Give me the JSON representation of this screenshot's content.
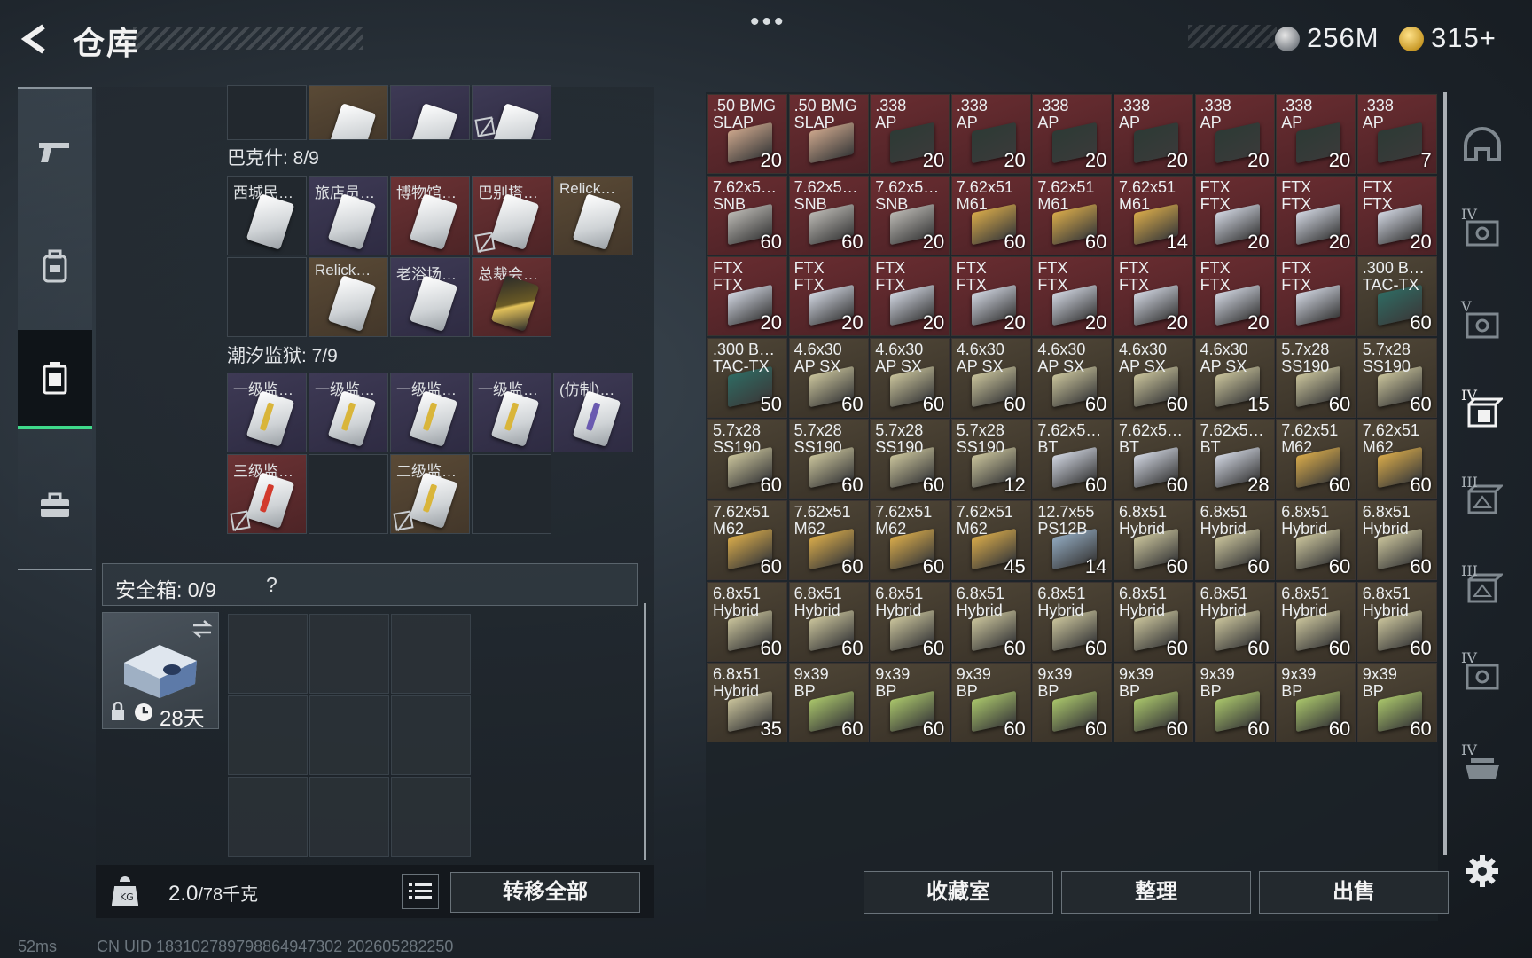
{
  "header": {
    "title": "仓库",
    "menu_dots": "•••",
    "currency_silver": "256M",
    "currency_gold": "315+"
  },
  "left_rail": {
    "items": [
      {
        "name": "weapons",
        "icon": "pistol-icon",
        "active": false
      },
      {
        "name": "gear",
        "icon": "backpack-icon",
        "active": false
      },
      {
        "name": "containers",
        "icon": "case-icon",
        "active": true
      },
      {
        "name": "toolbox",
        "icon": "toolbox-icon",
        "active": false
      }
    ]
  },
  "containers": {
    "top_row": [
      {
        "label": "",
        "color": "dark",
        "card": "none"
      },
      {
        "label": "",
        "color": "brown",
        "card": "white"
      },
      {
        "label": "",
        "color": "purple",
        "card": "white"
      },
      {
        "label": "",
        "color": "purple",
        "card": "white",
        "no_drop": true
      }
    ],
    "bakeshi": {
      "label": "巴克什: 8/9",
      "cells": [
        {
          "label": "西城民…",
          "color": "dark",
          "card": "white"
        },
        {
          "label": "旅店员…",
          "color": "purple",
          "card": "white"
        },
        {
          "label": "博物馆…",
          "color": "red",
          "card": "white"
        },
        {
          "label": "巴别塔…",
          "color": "red",
          "card": "white",
          "no_drop": true
        },
        {
          "label": "Relick…",
          "color": "brown",
          "card": "white"
        },
        {
          "label": "",
          "color": "dark",
          "card": "none"
        },
        {
          "label": "Relick…",
          "color": "brown",
          "card": "white"
        },
        {
          "label": "老浴场…",
          "color": "purple",
          "card": "white"
        },
        {
          "label": "总裁会…",
          "color": "red",
          "card": "gold"
        }
      ]
    },
    "prison": {
      "label": "潮汐监狱: 7/9",
      "cells": [
        {
          "label": "一级监…",
          "color": "purple",
          "card": "white",
          "stripe": "#d9b53a"
        },
        {
          "label": "一级监…",
          "color": "purple",
          "card": "white",
          "stripe": "#d9b53a"
        },
        {
          "label": "一级监…",
          "color": "purple",
          "card": "white",
          "stripe": "#d9b53a"
        },
        {
          "label": "一级监…",
          "color": "purple",
          "card": "white",
          "stripe": "#d9b53a"
        },
        {
          "label": "(仿制)…",
          "color": "purple",
          "card": "white",
          "stripe": "#6a5ab0"
        },
        {
          "label": "三级监…",
          "color": "red",
          "card": "white",
          "stripe": "#d23a2c",
          "no_drop": true
        },
        {
          "label": "",
          "color": "dark",
          "card": "none"
        },
        {
          "label": "二级监…",
          "color": "brown",
          "card": "white",
          "stripe": "#d9b53a",
          "no_drop": true
        },
        {
          "label": "",
          "color": "dark",
          "card": "none"
        }
      ]
    }
  },
  "safebox": {
    "label": "安全箱: 0/9",
    "help": "?",
    "timer": "28天"
  },
  "capacity": {
    "current": "2.0",
    "max": "/78千克",
    "transfer_all": "转移全部"
  },
  "status": {
    "ping": "52ms",
    "uid": "CN UID 18310278979886494730​2 202605282250"
  },
  "inventory": {
    "items": [
      {
        "l1": ".50 BMG",
        "l2": "SLAP",
        "count": "20",
        "color": "red",
        "box": "slap"
      },
      {
        "l1": ".50 BMG",
        "l2": "SLAP",
        "count": "",
        "color": "red",
        "box": "slap"
      },
      {
        "l1": ".338",
        "l2": "AP",
        "count": "20",
        "color": "red",
        "box": "black"
      },
      {
        "l1": ".338",
        "l2": "AP",
        "count": "20",
        "color": "red",
        "box": "black"
      },
      {
        "l1": ".338",
        "l2": "AP",
        "count": "20",
        "color": "red",
        "box": "black"
      },
      {
        "l1": ".338",
        "l2": "AP",
        "count": "20",
        "color": "red",
        "box": "black"
      },
      {
        "l1": ".338",
        "l2": "AP",
        "count": "20",
        "color": "red",
        "box": "black"
      },
      {
        "l1": ".338",
        "l2": "AP",
        "count": "20",
        "color": "red",
        "box": "black"
      },
      {
        "l1": ".338",
        "l2": "AP",
        "count": "7",
        "color": "red",
        "box": "black"
      },
      {
        "l1": "7.62x5…",
        "l2": "SNB",
        "count": "60",
        "color": "red",
        "box": "silver"
      },
      {
        "l1": "7.62x5…",
        "l2": "SNB",
        "count": "60",
        "color": "red",
        "box": "silver"
      },
      {
        "l1": "7.62x5…",
        "l2": "SNB",
        "count": "20",
        "color": "red",
        "box": "silver"
      },
      {
        "l1": "7.62x51",
        "l2": "M61",
        "count": "60",
        "color": "red",
        "box": "gold"
      },
      {
        "l1": "7.62x51",
        "l2": "M61",
        "count": "60",
        "color": "red",
        "box": "gold"
      },
      {
        "l1": "7.62x51",
        "l2": "M61",
        "count": "14",
        "color": "red",
        "box": "gold"
      },
      {
        "l1": "FTX",
        "l2": "FTX",
        "count": "20",
        "color": "red",
        "box": "white"
      },
      {
        "l1": "FTX",
        "l2": "FTX",
        "count": "20",
        "color": "red",
        "box": "white"
      },
      {
        "l1": "FTX",
        "l2": "FTX",
        "count": "20",
        "color": "red",
        "box": "white"
      },
      {
        "l1": "FTX",
        "l2": "FTX",
        "count": "20",
        "color": "red",
        "box": "white"
      },
      {
        "l1": "FTX",
        "l2": "FTX",
        "count": "20",
        "color": "red",
        "box": "white"
      },
      {
        "l1": "FTX",
        "l2": "FTX",
        "count": "20",
        "color": "red",
        "box": "white"
      },
      {
        "l1": "FTX",
        "l2": "FTX",
        "count": "20",
        "color": "red",
        "box": "white"
      },
      {
        "l1": "FTX",
        "l2": "FTX",
        "count": "20",
        "color": "red",
        "box": "white"
      },
      {
        "l1": "FTX",
        "l2": "FTX",
        "count": "20",
        "color": "red",
        "box": "white"
      },
      {
        "l1": "FTX",
        "l2": "FTX",
        "count": "20",
        "color": "red",
        "box": "white"
      },
      {
        "l1": "FTX",
        "l2": "FTX",
        "count": "",
        "color": "red",
        "box": "white"
      },
      {
        "l1": ".300 B…",
        "l2": "TAC-TX",
        "count": "60",
        "color": "brown",
        "box": "teal"
      },
      {
        "l1": ".300 B…",
        "l2": "TAC-TX",
        "count": "50",
        "color": "brown",
        "box": "teal"
      },
      {
        "l1": "4.6x30",
        "l2": "AP SX",
        "count": "60",
        "color": "brown",
        "box": "khaki"
      },
      {
        "l1": "4.6x30",
        "l2": "AP SX",
        "count": "60",
        "color": "brown",
        "box": "khaki"
      },
      {
        "l1": "4.6x30",
        "l2": "AP SX",
        "count": "60",
        "color": "brown",
        "box": "khaki"
      },
      {
        "l1": "4.6x30",
        "l2": "AP SX",
        "count": "60",
        "color": "brown",
        "box": "khaki"
      },
      {
        "l1": "4.6x30",
        "l2": "AP SX",
        "count": "60",
        "color": "brown",
        "box": "khaki"
      },
      {
        "l1": "4.6x30",
        "l2": "AP SX",
        "count": "15",
        "color": "brown",
        "box": "khaki"
      },
      {
        "l1": "5.7x28",
        "l2": "SS190",
        "count": "60",
        "color": "brown",
        "box": "khaki"
      },
      {
        "l1": "5.7x28",
        "l2": "SS190",
        "count": "60",
        "color": "brown",
        "box": "khaki"
      },
      {
        "l1": "5.7x28",
        "l2": "SS190",
        "count": "60",
        "color": "brown",
        "box": "khaki"
      },
      {
        "l1": "5.7x28",
        "l2": "SS190",
        "count": "60",
        "color": "brown",
        "box": "khaki"
      },
      {
        "l1": "5.7x28",
        "l2": "SS190",
        "count": "60",
        "color": "brown",
        "box": "khaki"
      },
      {
        "l1": "5.7x28",
        "l2": "SS190",
        "count": "12",
        "color": "brown",
        "box": "khaki"
      },
      {
        "l1": "7.62x5…",
        "l2": "BT",
        "count": "60",
        "color": "brown",
        "box": "white"
      },
      {
        "l1": "7.62x5…",
        "l2": "BT",
        "count": "60",
        "color": "brown",
        "box": "white"
      },
      {
        "l1": "7.62x5…",
        "l2": "BT",
        "count": "28",
        "color": "brown",
        "box": "white"
      },
      {
        "l1": "7.62x51",
        "l2": "M62",
        "count": "60",
        "color": "brown",
        "box": "gold"
      },
      {
        "l1": "7.62x51",
        "l2": "M62",
        "count": "60",
        "color": "brown",
        "box": "gold"
      },
      {
        "l1": "7.62x51",
        "l2": "M62",
        "count": "60",
        "color": "brown",
        "box": "gold"
      },
      {
        "l1": "7.62x51",
        "l2": "M62",
        "count": "60",
        "color": "brown",
        "box": "gold"
      },
      {
        "l1": "7.62x51",
        "l2": "M62",
        "count": "60",
        "color": "brown",
        "box": "gold"
      },
      {
        "l1": "7.62x51",
        "l2": "M62",
        "count": "45",
        "color": "brown",
        "box": "gold"
      },
      {
        "l1": "12.7x55",
        "l2": "PS12B",
        "count": "14",
        "color": "brown",
        "box": "blue"
      },
      {
        "l1": "6.8x51",
        "l2": "Hybrid",
        "count": "60",
        "color": "brown",
        "box": "khaki"
      },
      {
        "l1": "6.8x51",
        "l2": "Hybrid",
        "count": "60",
        "color": "brown",
        "box": "khaki"
      },
      {
        "l1": "6.8x51",
        "l2": "Hybrid",
        "count": "60",
        "color": "brown",
        "box": "khaki"
      },
      {
        "l1": "6.8x51",
        "l2": "Hybrid",
        "count": "60",
        "color": "brown",
        "box": "khaki"
      },
      {
        "l1": "6.8x51",
        "l2": "Hybrid",
        "count": "60",
        "color": "brown",
        "box": "khaki"
      },
      {
        "l1": "6.8x51",
        "l2": "Hybrid",
        "count": "60",
        "color": "brown",
        "box": "khaki"
      },
      {
        "l1": "6.8x51",
        "l2": "Hybrid",
        "count": "60",
        "color": "brown",
        "box": "khaki"
      },
      {
        "l1": "6.8x51",
        "l2": "Hybrid",
        "count": "60",
        "color": "brown",
        "box": "khaki"
      },
      {
        "l1": "6.8x51",
        "l2": "Hybrid",
        "count": "60",
        "color": "brown",
        "box": "khaki"
      },
      {
        "l1": "6.8x51",
        "l2": "Hybrid",
        "count": "60",
        "color": "brown",
        "box": "khaki"
      },
      {
        "l1": "6.8x51",
        "l2": "Hybrid",
        "count": "60",
        "color": "brown",
        "box": "khaki"
      },
      {
        "l1": "6.8x51",
        "l2": "Hybrid",
        "count": "60",
        "color": "brown",
        "box": "khaki"
      },
      {
        "l1": "6.8x51",
        "l2": "Hybrid",
        "count": "60",
        "color": "brown",
        "box": "khaki"
      },
      {
        "l1": "6.8x51",
        "l2": "Hybrid",
        "count": "35",
        "color": "brown",
        "box": "khaki"
      },
      {
        "l1": "9x39",
        "l2": "BP",
        "count": "60",
        "color": "brown",
        "box": "green"
      },
      {
        "l1": "9x39",
        "l2": "BP",
        "count": "60",
        "color": "brown",
        "box": "green"
      },
      {
        "l1": "9x39",
        "l2": "BP",
        "count": "60",
        "color": "brown",
        "box": "green"
      },
      {
        "l1": "9x39",
        "l2": "BP",
        "count": "60",
        "color": "brown",
        "box": "green"
      },
      {
        "l1": "9x39",
        "l2": "BP",
        "count": "60",
        "color": "brown",
        "box": "green"
      },
      {
        "l1": "9x39",
        "l2": "BP",
        "count": "60",
        "color": "brown",
        "box": "green"
      },
      {
        "l1": "9x39",
        "l2": "BP",
        "count": "60",
        "color": "brown",
        "box": "green"
      },
      {
        "l1": "9x39",
        "l2": "BP",
        "count": "60",
        "color": "brown",
        "box": "green"
      }
    ],
    "box_colors": {
      "slap": "#c9a48a",
      "black": "#2d3a35",
      "silver": "#b9b7b2",
      "gold": "#d6a94a",
      "white": "#cfd4df",
      "teal": "#2f6a62",
      "khaki": "#c8c29a",
      "blue": "#8fa7bd",
      "green": "#a8c46a"
    }
  },
  "actions": {
    "collection": "收藏室",
    "sort": "整理",
    "sell": "出售"
  },
  "right_rail": {
    "items": [
      {
        "num": "",
        "icon": "helmet-icon",
        "active": false
      },
      {
        "num": "IV",
        "icon": "armor-icon",
        "active": false
      },
      {
        "num": "V",
        "icon": "armor-icon",
        "active": false
      },
      {
        "num": "IV",
        "icon": "ammo-box-icon",
        "active": true
      },
      {
        "num": "III",
        "icon": "ammo-box-icon",
        "active": false
      },
      {
        "num": "III",
        "icon": "ammo-box-icon",
        "active": false
      },
      {
        "num": "IV",
        "icon": "armor-icon",
        "active": false
      },
      {
        "num": "IV",
        "icon": "rig-icon",
        "active": false
      }
    ]
  },
  "colors": {
    "accent_green": "#3fd98a",
    "cell_red": "#6a2d31",
    "cell_brown": "#4f4637",
    "cell_purple": "#3e3a55"
  }
}
